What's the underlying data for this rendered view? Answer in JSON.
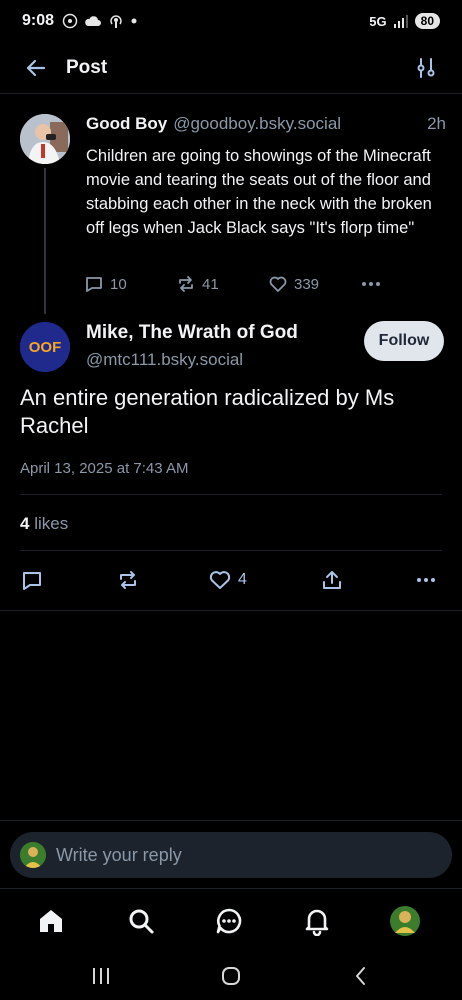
{
  "status_bar": {
    "time": "9:08",
    "network": "5G",
    "battery": "80"
  },
  "header": {
    "title": "Post"
  },
  "parent_post": {
    "author_name": "Good Boy",
    "author_handle": "@goodboy.bsky.social",
    "time": "2h",
    "text": "Children are going to showings of the Minecraft movie and tearing the seats out of the floor and stabbing each other in the neck with the broken off legs when Jack Black says \"It's florp time\"",
    "replies": "10",
    "reposts": "41",
    "likes": "339"
  },
  "main_post": {
    "author_name": "Mike, The Wrath of God",
    "author_handle": "@mtc111.bsky.social",
    "avatar_text": "OOF",
    "follow_label": "Follow",
    "text": "An entire generation radicalized by Ms Rachel",
    "timestamp": "April 13, 2025 at 7:43 AM",
    "likes_count": "4",
    "likes_label": "likes",
    "like_action_count": "4"
  },
  "reply_bar": {
    "placeholder": "Write your reply"
  },
  "icons": {
    "back": "arrow-left-icon",
    "filter": "sliders-icon",
    "reply": "speech-bubble-icon",
    "repost": "repost-icon",
    "like": "heart-icon",
    "share": "share-icon",
    "more": "ellipsis-icon",
    "nav": [
      "home-icon",
      "search-icon",
      "chat-icon",
      "bell-icon",
      "profile-avatar"
    ]
  },
  "colors": {
    "background": "#000000",
    "text_secondary": "#8a98a8",
    "divider": "#1c232b",
    "follow_bg": "#e1e6ec"
  }
}
